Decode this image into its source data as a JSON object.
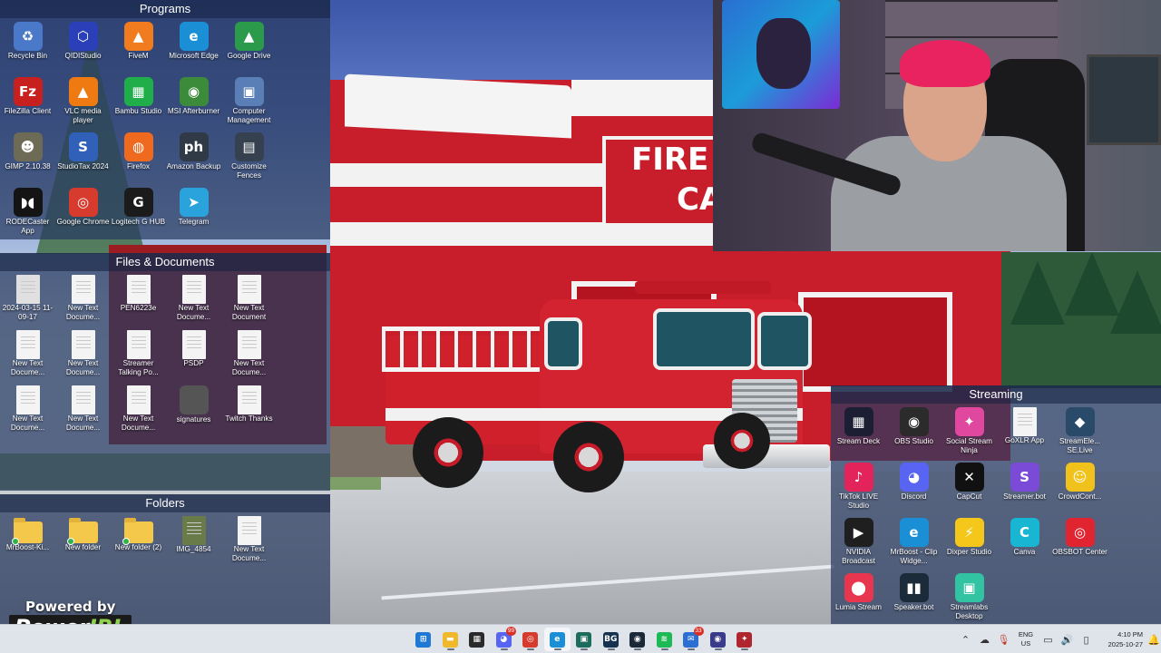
{
  "fences": {
    "programs": {
      "title": "Programs",
      "items": [
        {
          "label": "Recycle Bin",
          "icon": "recycle-bin-icon",
          "color": "#4a79c9",
          "glyph": "♻"
        },
        {
          "label": "QIDIStudio",
          "icon": "qidistudio-icon",
          "color": "#2a3fb8",
          "glyph": "⬡"
        },
        {
          "label": "FiveM",
          "icon": "fivem-icon",
          "color": "#f07c1f",
          "glyph": "▲"
        },
        {
          "label": "Microsoft Edge",
          "icon": "edge-icon",
          "color": "#1b8fd6",
          "glyph": "e"
        },
        {
          "label": "Google Drive",
          "icon": "google-drive-icon",
          "color": "#2b9a4a",
          "glyph": "▲"
        },
        {
          "label": "FileZilla Client",
          "icon": "filezilla-icon",
          "color": "#c7201f",
          "glyph": "Fz"
        },
        {
          "label": "VLC media player",
          "icon": "vlc-icon",
          "color": "#f07a12",
          "glyph": "▲"
        },
        {
          "label": "Bambu Studio",
          "icon": "bambu-studio-icon",
          "color": "#1fae4a",
          "glyph": "▦"
        },
        {
          "label": "MSI Afterburner",
          "icon": "msi-afterburner-icon",
          "color": "#3b8b3b",
          "glyph": "◉"
        },
        {
          "label": "Computer Management",
          "icon": "computer-management-icon",
          "color": "#5a7fb6",
          "glyph": "▣"
        },
        {
          "label": "GIMP 2.10.38",
          "icon": "gimp-icon",
          "color": "#6d6a55",
          "glyph": "☻"
        },
        {
          "label": "StudioTax 2024",
          "icon": "studiotax-icon",
          "color": "#3060b8",
          "glyph": "S"
        },
        {
          "label": "Firefox",
          "icon": "firefox-icon",
          "color": "#ef6a1f",
          "glyph": "◍"
        },
        {
          "label": "Amazon Backup",
          "icon": "amazon-photos-icon",
          "color": "#2f3a46",
          "glyph": "ph"
        },
        {
          "label": "Customize Fences",
          "icon": "fences-icon",
          "color": "#36414f",
          "glyph": "▤"
        },
        {
          "label": "RODECaster App",
          "icon": "rodecaster-icon",
          "color": "#141414",
          "glyph": "◗◖"
        },
        {
          "label": "Google Chrome",
          "icon": "chrome-icon",
          "color": "#d63b2e",
          "glyph": "◎"
        },
        {
          "label": "Logitech G HUB",
          "icon": "logitech-ghub-icon",
          "color": "#1b1b1b",
          "glyph": "G"
        },
        {
          "label": "Telegram",
          "icon": "telegram-icon",
          "color": "#2aa3dd",
          "glyph": "➤"
        }
      ]
    },
    "files": {
      "title": "Files & Documents",
      "items": [
        {
          "label": "2024-03-15 11-09-17",
          "icon": "image-file-icon"
        },
        {
          "label": "New Text Docume...",
          "icon": "text-document-icon"
        },
        {
          "label": "PEN6223e",
          "icon": "text-document-icon"
        },
        {
          "label": "New Text Docume...",
          "icon": "text-document-icon"
        },
        {
          "label": "New Text Document",
          "icon": "text-document-icon"
        },
        {
          "label": "New Text Docume...",
          "icon": "text-document-icon"
        },
        {
          "label": "New Text Docume...",
          "icon": "text-document-icon"
        },
        {
          "label": "Streamer Talking Po...",
          "icon": "text-document-icon"
        },
        {
          "label": "PSDP",
          "icon": "text-document-icon"
        },
        {
          "label": "New Text Docume...",
          "icon": "text-document-icon"
        },
        {
          "label": "New Text Docume...",
          "icon": "text-document-icon"
        },
        {
          "label": "New Text Docume...",
          "icon": "text-document-icon"
        },
        {
          "label": "New Text Docume...",
          "icon": "text-document-icon"
        },
        {
          "label": "signatures",
          "icon": "edge-icon"
        },
        {
          "label": "Twitch Thanks",
          "icon": "text-document-icon"
        }
      ]
    },
    "folders": {
      "title": "Folders",
      "items": [
        {
          "label": "MrBoost-Ki...",
          "icon": "folder-icon"
        },
        {
          "label": "New folder",
          "icon": "folder-icon"
        },
        {
          "label": "New folder (2)",
          "icon": "folder-icon"
        },
        {
          "label": "IMG_4854",
          "icon": "image-file-icon"
        },
        {
          "label": "New Text Docume...",
          "icon": "text-document-icon"
        }
      ]
    },
    "streaming": {
      "title": "Streaming",
      "items": [
        {
          "label": "Stream Deck",
          "icon": "stream-deck-icon",
          "color": "#1c1f33",
          "glyph": "▦"
        },
        {
          "label": "OBS Studio",
          "icon": "obs-studio-icon",
          "color": "#2b2b2b",
          "glyph": "◉"
        },
        {
          "label": "Social Stream Ninja",
          "icon": "social-stream-ninja-icon",
          "color": "#e0479e",
          "glyph": "✦"
        },
        {
          "label": "GoXLR App",
          "icon": "text-document-icon",
          "color": "#f4f4f4",
          "glyph": ""
        },
        {
          "label": "StreamEle... SE.Live",
          "icon": "streamelements-icon",
          "color": "#2a4a6a",
          "glyph": "◆"
        },
        {
          "label": "TikTok LIVE Studio",
          "icon": "tiktok-live-icon",
          "color": "#e3245a",
          "glyph": "♪"
        },
        {
          "label": "Discord",
          "icon": "discord-icon",
          "color": "#5865f2",
          "glyph": "◕"
        },
        {
          "label": "CapCut",
          "icon": "capcut-icon",
          "color": "#111111",
          "glyph": "✕"
        },
        {
          "label": "Streamer.bot",
          "icon": "streamer-bot-icon",
          "color": "#7a4bd6",
          "glyph": "S"
        },
        {
          "label": "CrowdCont...",
          "icon": "crowdcontrol-icon",
          "color": "#f2c21c",
          "glyph": "☺"
        },
        {
          "label": "NVIDIA Broadcast",
          "icon": "nvidia-broadcast-icon",
          "color": "#1f1f1f",
          "glyph": "▶"
        },
        {
          "label": "MrBoost - Clip Widge...",
          "icon": "edge-icon",
          "color": "#1b8fd6",
          "glyph": "e"
        },
        {
          "label": "Dixper Studio",
          "icon": "dixper-icon",
          "color": "#f5c71a",
          "glyph": "⚡"
        },
        {
          "label": "Canva",
          "icon": "canva-icon",
          "color": "#19b6d4",
          "glyph": "C"
        },
        {
          "label": "OBSBOT Center",
          "icon": "obsbot-icon",
          "color": "#e02430",
          "glyph": "◎"
        },
        {
          "label": "Lumia Stream",
          "icon": "lumia-stream-icon",
          "color": "#e8364f",
          "glyph": "⬤"
        },
        {
          "label": "Speaker.bot",
          "icon": "speaker-bot-icon",
          "color": "#1c2b3a",
          "glyph": "▮▮"
        },
        {
          "label": "Streamlabs Desktop",
          "icon": "streamlabs-icon",
          "color": "#31c3a2",
          "glyph": "▣"
        }
      ]
    }
  },
  "wallpaper": {
    "sign_line1": "FIRE",
    "sign_line2": "CA"
  },
  "watermark": {
    "powered_by": "Powered by",
    "brand_power": "Power",
    "brand_irl": "IRL"
  },
  "taskbar": {
    "apps": [
      {
        "name": "start-button",
        "color": "#1e78d4",
        "glyph": "⊞",
        "active": false,
        "badge": ""
      },
      {
        "name": "file-explorer-icon",
        "color": "#f0b92c",
        "glyph": "▬",
        "active": false,
        "badge": ""
      },
      {
        "name": "microsoft-store-icon",
        "color": "#2a2a2a",
        "glyph": "▦",
        "active": false,
        "badge": ""
      },
      {
        "name": "discord-taskbar-icon",
        "color": "#5865f2",
        "glyph": "◕",
        "active": false,
        "badge": "99"
      },
      {
        "name": "chrome-taskbar-icon",
        "color": "#d63b2e",
        "glyph": "◎",
        "active": false,
        "badge": ""
      },
      {
        "name": "edge-taskbar-icon",
        "color": "#1b8fd6",
        "glyph": "e",
        "active": true,
        "badge": ""
      },
      {
        "name": "streamlabs-taskbar-icon",
        "color": "#1c6b5b",
        "glyph": "▣",
        "active": false,
        "badge": ""
      },
      {
        "name": "bg-app-taskbar-icon",
        "color": "#15324e",
        "glyph": "BG",
        "active": false,
        "badge": ""
      },
      {
        "name": "steam-taskbar-icon",
        "color": "#1b2838",
        "glyph": "◉",
        "active": false,
        "badge": ""
      },
      {
        "name": "spotify-taskbar-icon",
        "color": "#1db954",
        "glyph": "≋",
        "active": false,
        "badge": ""
      },
      {
        "name": "messages-taskbar-icon",
        "color": "#2a6fd1",
        "glyph": "✉",
        "active": false,
        "badge": "33"
      },
      {
        "name": "obs-taskbar-icon",
        "color": "#3a3a8a",
        "glyph": "◉",
        "active": false,
        "badge": ""
      },
      {
        "name": "streamer-tool-taskbar-icon",
        "color": "#b0262f",
        "glyph": "✦",
        "active": false,
        "badge": ""
      }
    ],
    "tray": {
      "language": "ENG",
      "region": "US",
      "time": "4:10 PM",
      "date": "2025-10-27"
    }
  }
}
